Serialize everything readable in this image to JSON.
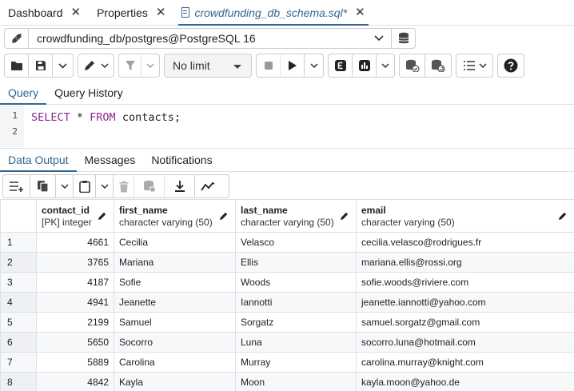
{
  "tabs": [
    {
      "label": "Dashboard",
      "close": "✕"
    },
    {
      "label": "Properties",
      "close": "✕"
    },
    {
      "label": "crowdfunding_db_schema.sql*",
      "close": "✕"
    }
  ],
  "connection": {
    "label": "crowdfunding_db/postgres@PostgreSQL 16"
  },
  "toolbar": {
    "limit_value": "No limit"
  },
  "query_tabs": [
    "Query",
    "Query History"
  ],
  "editor": {
    "line_numbers": [
      "1",
      "2"
    ]
  },
  "output_tabs": [
    "Data Output",
    "Messages",
    "Notifications"
  ],
  "table": {
    "columns": [
      {
        "name": "contact_id",
        "type": "[PK] integer"
      },
      {
        "name": "first_name",
        "type": "character varying (50)"
      },
      {
        "name": "last_name",
        "type": "character varying (50)"
      },
      {
        "name": "email",
        "type": "character varying (50)"
      }
    ],
    "rows": [
      [
        "1",
        "4661",
        "Cecilia",
        "Velasco",
        "cecilia.velasco@rodrigues.fr"
      ],
      [
        "2",
        "3765",
        "Mariana",
        "Ellis",
        "mariana.ellis@rossi.org"
      ],
      [
        "3",
        "4187",
        "Sofie",
        "Woods",
        "sofie.woods@riviere.com"
      ],
      [
        "4",
        "4941",
        "Jeanette",
        "Iannotti",
        "jeanette.iannotti@yahoo.com"
      ],
      [
        "5",
        "2199",
        "Samuel",
        "Sorgatz",
        "samuel.sorgatz@gmail.com"
      ],
      [
        "6",
        "5650",
        "Socorro",
        "Luna",
        "socorro.luna@hotmail.com"
      ],
      [
        "7",
        "5889",
        "Carolina",
        "Murray",
        "carolina.murray@knight.com"
      ],
      [
        "8",
        "4842",
        "Kayla",
        "Moon",
        "kayla.moon@yahoo.de"
      ]
    ]
  },
  "colors": {
    "accent": "#326690",
    "keyword": "#8a2d8a",
    "border": "#c9cdd4"
  }
}
